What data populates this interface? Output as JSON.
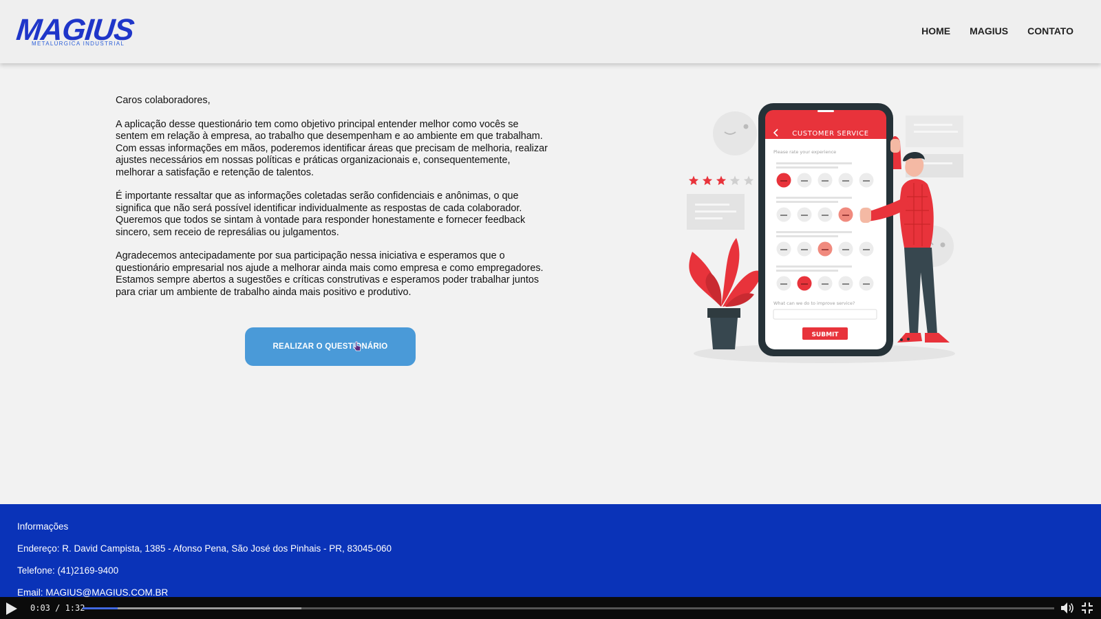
{
  "header": {
    "logo_text": "MAGIUS",
    "logo_subtitle": "METALÚRGICA INDUSTRIAL",
    "nav": [
      "HOME",
      "MAGIUS",
      "CONTATO"
    ]
  },
  "main": {
    "paragraphs": [
      "Caros colaboradores,",
      "A aplicação desse questionário tem como objetivo principal entender melhor como vocês se sentem em relação à empresa, ao trabalho que desempenham e ao ambiente em que trabalham. Com essas informações em mãos, poderemos identificar áreas que precisam de melhoria, realizar ajustes necessários em nossas políticas e práticas organizacionais e, consequentemente, melhorar a satisfação e retenção de talentos.",
      "É importante ressaltar que as informações coletadas serão confidenciais e anônimas, o que significa que não será possível identificar individualmente as respostas de cada colaborador. Queremos que todos se sintam à vontade para responder honestamente e fornecer feedback sincero, sem receio de represálias ou julgamentos.",
      "Agradecemos antecipadamente por sua participação nessa iniciativa e esperamos que o questionário empresarial nos ajude a melhorar ainda mais como empresa e como empregadores. Estamos sempre abertos a sugestões e críticas construtivas e esperamos poder trabalhar juntos para criar um ambiente de trabalho ainda mais positivo e produtivo."
    ],
    "cta_label": "REALIZAR O QUESTIONÁRIO"
  },
  "illustration": {
    "app_title": "CUSTOMER SERVICE",
    "rate_prompt": "Please rate your experience",
    "improve_prompt": "What can we do to improve service?",
    "submit_label": "SUBMIT",
    "rating": 3,
    "rating_max": 5
  },
  "footer": {
    "title": "Informações",
    "address": "Endereço: R. David Campista, 1385 - Afonso Pena, São José dos Pinhais - PR, 83045-060",
    "phone": "Telefone: (41)2169-9400",
    "email": "Email: MAGIUS@MAGIUS.COM.BR"
  },
  "video": {
    "time": "0:03 / 1:32",
    "played_fraction": 0.036,
    "buffered_fraction": 0.225
  },
  "colors": {
    "brand_blue": "#1f36c9",
    "footer_blue": "#0a33b8",
    "button_blue": "#4a9ad8",
    "accent_red": "#e8333b"
  }
}
